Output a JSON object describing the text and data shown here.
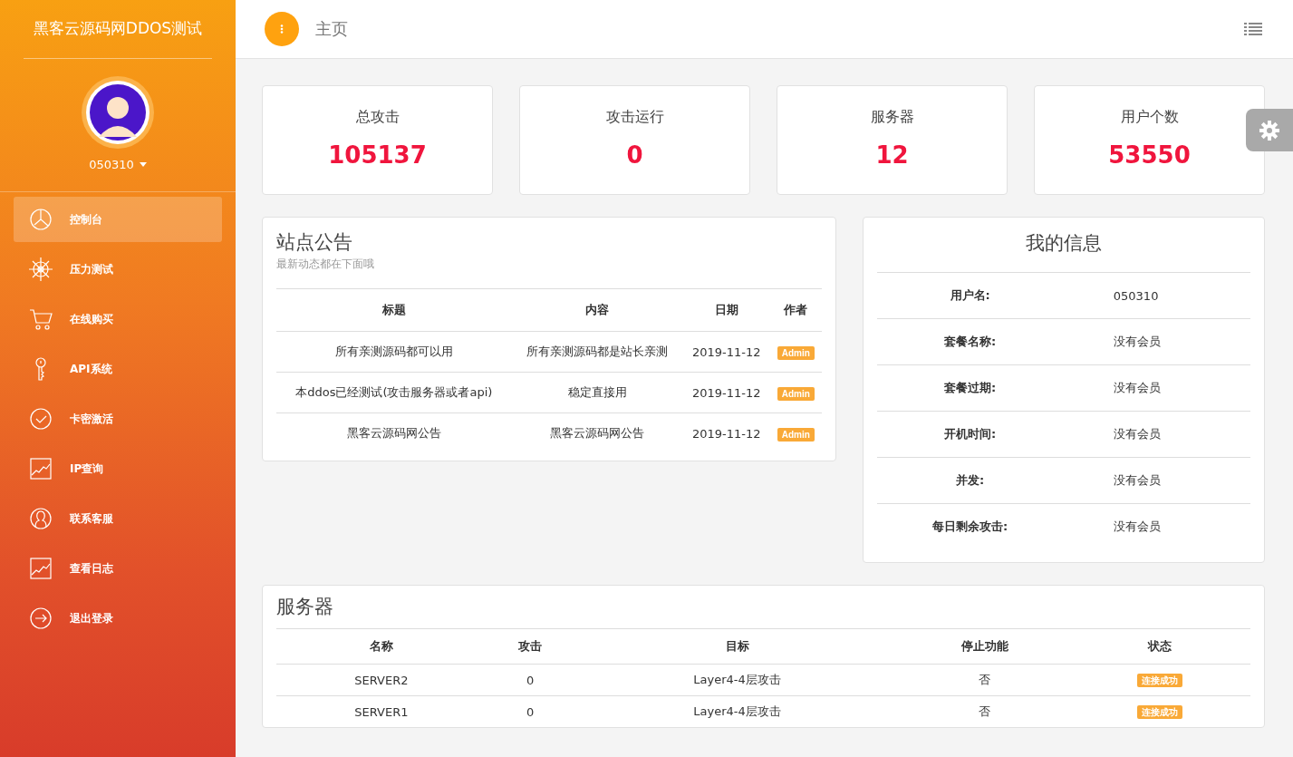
{
  "sidebar": {
    "site_title": "黑客云源码网DDOS测试",
    "username": "050310",
    "items": [
      {
        "label": "控制台",
        "kind": "pie",
        "selected": true
      },
      {
        "label": "压力测试",
        "kind": "wheel",
        "selected": false
      },
      {
        "label": "在线购买",
        "kind": "cart",
        "selected": false
      },
      {
        "label": "API系统",
        "kind": "key",
        "selected": false
      },
      {
        "label": "卡密激活",
        "kind": "check",
        "selected": false
      },
      {
        "label": "IP查询",
        "kind": "chart",
        "selected": false
      },
      {
        "label": "联系客服",
        "kind": "user",
        "selected": false
      },
      {
        "label": "查看日志",
        "kind": "chart",
        "selected": false
      },
      {
        "label": "退出登录",
        "kind": "exit",
        "selected": false
      }
    ]
  },
  "topbar": {
    "title": "主页"
  },
  "stats": [
    {
      "label": "总攻击",
      "value": "105137"
    },
    {
      "label": "攻击运行",
      "value": "0"
    },
    {
      "label": "服务器",
      "value": "12"
    },
    {
      "label": "用户个数",
      "value": "53550"
    }
  ],
  "announcements": {
    "title": "站点公告",
    "subtitle": "最新动态都在下面哦",
    "columns": [
      "标题",
      "内容",
      "日期",
      "作者"
    ],
    "rows": [
      {
        "title": "所有亲测源码都可以用",
        "content": "所有亲测源码都是站长亲测",
        "date": "2019-11-12",
        "author": "Admin"
      },
      {
        "title": "本ddos已经测试(攻击服务器或者api)",
        "content": "稳定直接用",
        "date": "2019-11-12",
        "author": "Admin"
      },
      {
        "title": "黑客云源码网公告",
        "content": "黑客云源码网公告",
        "date": "2019-11-12",
        "author": "Admin"
      }
    ]
  },
  "my_info": {
    "title": "我的信息",
    "rows": [
      {
        "label": "用户名:",
        "value": "050310"
      },
      {
        "label": "套餐名称:",
        "value": "没有会员"
      },
      {
        "label": "套餐过期:",
        "value": "没有会员"
      },
      {
        "label": "开机时间:",
        "value": "没有会员"
      },
      {
        "label": "并发:",
        "value": "没有会员"
      },
      {
        "label": "每日剩余攻击:",
        "value": "没有会员"
      }
    ]
  },
  "servers": {
    "title": "服务器",
    "columns": [
      "名称",
      "攻击",
      "目标",
      "停止功能",
      "状态"
    ],
    "rows": [
      {
        "name": "SERVER2",
        "attacks": "0",
        "target": "Layer4-4层攻击",
        "stop": "否",
        "status": "连接成功"
      },
      {
        "name": "SERVER1",
        "attacks": "0",
        "target": "Layer4-4层攻击",
        "stop": "否",
        "status": "连接成功"
      }
    ]
  }
}
